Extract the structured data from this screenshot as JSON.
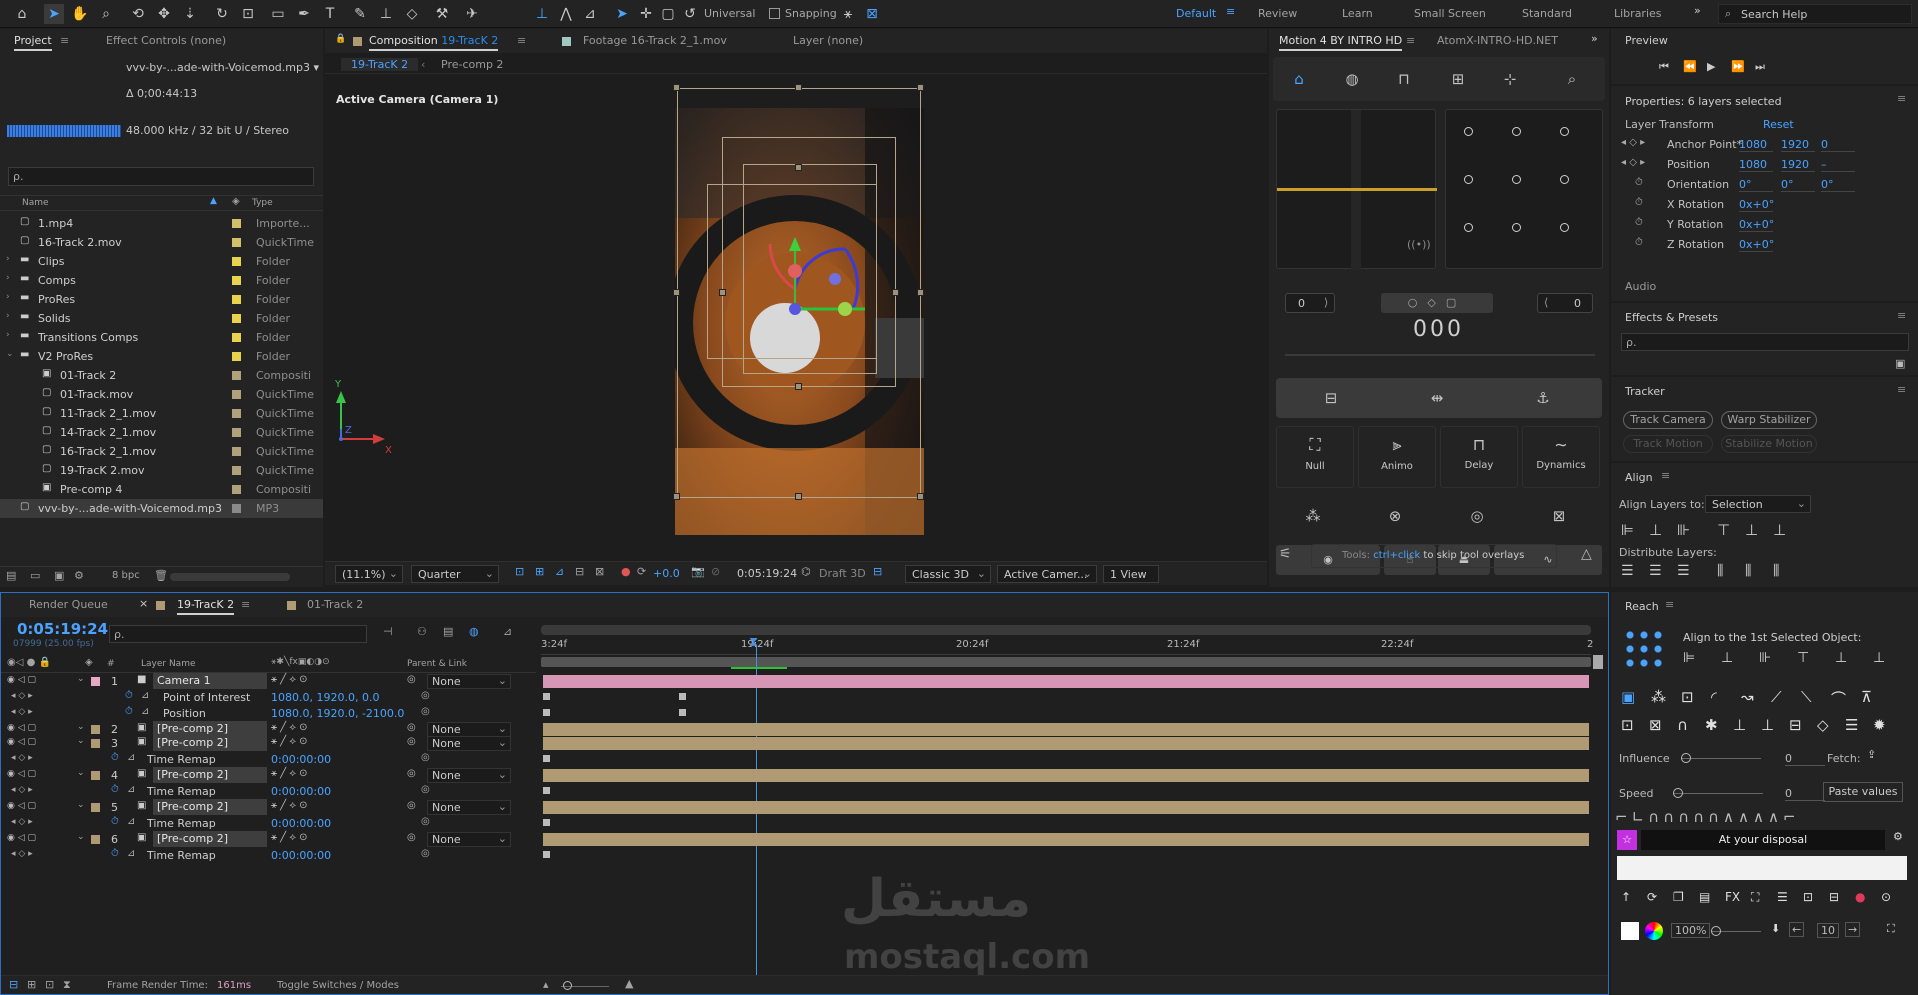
{
  "toolbar": {
    "universal_label": "Universal",
    "snapping_label": "Snapping",
    "workspaces": [
      "Default",
      "Review",
      "Learn",
      "Small Screen",
      "Standard",
      "Libraries"
    ],
    "search_placeholder": "Search Help"
  },
  "project": {
    "tab_project": "Project",
    "tab_effect_controls": "Effect Controls (none)",
    "selected_file": "vvv-by-...ade-with-Voicemod.mp3 ▾",
    "duration": "Δ 0;00:44:13",
    "audio_info": "48.000 kHz / 32 bit U / Stereo",
    "search_placeholder": "ρ.",
    "col_name": "Name",
    "col_type": "Type",
    "items": [
      {
        "name": "1.mp4",
        "type": "Importe...",
        "color": "#d1c06a",
        "icon": "file-icon"
      },
      {
        "name": "16-Track 2.mov",
        "type": "QuickTime",
        "color": "#d1c06a",
        "icon": "file-icon"
      },
      {
        "name": "Clips",
        "type": "Folder",
        "color": "#e8d34e",
        "icon": "folder-icon"
      },
      {
        "name": "Comps",
        "type": "Folder",
        "color": "#e8d34e",
        "icon": "folder-icon"
      },
      {
        "name": "ProRes",
        "type": "Folder",
        "color": "#e8d34e",
        "icon": "folder-icon"
      },
      {
        "name": "Solids",
        "type": "Folder",
        "color": "#e8d34e",
        "icon": "folder-icon"
      },
      {
        "name": "Transitions Comps",
        "type": "Folder",
        "color": "#e8d34e",
        "icon": "folder-icon"
      },
      {
        "name": "V2 ProRes",
        "type": "Folder",
        "color": "#e8d34e",
        "icon": "folder-icon"
      },
      {
        "name": "01-Track 2",
        "type": "Compositi",
        "color": "#b0a07c",
        "icon": "comp-icon"
      },
      {
        "name": "01-Track.mov",
        "type": "QuickTime",
        "color": "#b0a07c",
        "icon": "file-icon"
      },
      {
        "name": "11-Track 2_1.mov",
        "type": "QuickTime",
        "color": "#b0a07c",
        "icon": "file-icon"
      },
      {
        "name": "14-Track 2_1.mov",
        "type": "QuickTime",
        "color": "#b0a07c",
        "icon": "file-icon"
      },
      {
        "name": "16-Track 2_1.mov",
        "type": "QuickTime",
        "color": "#b0a07c",
        "icon": "file-icon"
      },
      {
        "name": "19-TracK 2.mov",
        "type": "QuickTime",
        "color": "#b0a07c",
        "icon": "file-icon"
      },
      {
        "name": "Pre-comp 4",
        "type": "Compositi",
        "color": "#b0a07c",
        "icon": "comp-icon"
      },
      {
        "name": "vvv-by-...ade-with-Voicemod.mp3",
        "type": "MP3",
        "color": "#8a8a8a",
        "icon": "file-icon"
      }
    ],
    "bpc": "8 bpc"
  },
  "composition": {
    "tab_label": "Composition",
    "tab_comp_name": "19-TracK 2",
    "tab_footage": "Footage  16-Track 2_1.mov",
    "tab_layer": "Layer  (none)",
    "sub_tab_active": "19-TracK 2",
    "sub_tab_other": "Pre-comp 2",
    "camera_label": "Active Camera (Camera 1)",
    "zoom": "(11.1%)",
    "quality": "Quarter",
    "exposure": "+0.0",
    "timecode": "0:05:19:24",
    "draft": "Draft 3D",
    "renderer": "Classic 3D",
    "view_camera": "Active Camer...",
    "views": "1 View"
  },
  "motion": {
    "tab_motion": "Motion 4 BY INTRO HD",
    "tab_atom": "AtomX-INTRO-HD.NET",
    "counter_left": "0",
    "counter_right": "0",
    "big_value": "000",
    "tools": [
      "Null",
      "Animo",
      "Delay",
      "Dynamics"
    ],
    "tip_prefix": "Tools:",
    "tip_key": "ctrl+click",
    "tip_suffix": "to skip tool overlays"
  },
  "preview": {
    "title": "Preview"
  },
  "properties": {
    "title": "Properties: 6 layers selected",
    "section": "Layer Transform",
    "reset": "Reset",
    "rows": [
      {
        "label": "Anchor Point*",
        "v1": "1080",
        "v2": "1920",
        "v3": "0"
      },
      {
        "label": "Position",
        "v1": "1080",
        "v2": "1920",
        "v3": "–"
      },
      {
        "label": "Orientation",
        "v1": "0°",
        "v2": "0°",
        "v3": "0°"
      },
      {
        "label": "X Rotation",
        "v1": "0x+0°",
        "v2": "",
        "v3": ""
      },
      {
        "label": "Y Rotation",
        "v1": "0x+0°",
        "v2": "",
        "v3": ""
      },
      {
        "label": "Z Rotation",
        "v1": "0x+0°",
        "v2": "",
        "v3": ""
      }
    ],
    "audio": "Audio"
  },
  "effects": {
    "title": "Effects & Presets",
    "search_placeholder": "ρ."
  },
  "tracker": {
    "title": "Tracker",
    "track_camera": "Track Camera",
    "warp": "Warp Stabilizer",
    "track_motion": "Track Motion",
    "stabilize": "Stabilize Motion"
  },
  "align": {
    "title": "Align",
    "align_to_label": "Align Layers to:",
    "align_to_value": "Selection",
    "distribute": "Distribute Layers:"
  },
  "timeline": {
    "tab_render": "Render Queue",
    "tab_comp": "19-TracK 2",
    "tab_other": "01-Track 2",
    "timecode": "0:05:19:24",
    "frames": "07999 (25.00 fps)",
    "search_placeholder": "ρ.",
    "col_hash": "#",
    "col_layer": "Layer Name",
    "col_parent": "Parent & Link",
    "ruler": [
      "3:24f",
      "19:24f",
      "20:24f",
      "21:24f",
      "22:24f",
      "2"
    ],
    "layers": [
      {
        "num": "1",
        "name": "Camera 1",
        "parent": "None",
        "color": "#e8a7c3",
        "kind": "layer"
      },
      {
        "num": "",
        "name": "Point of Interest",
        "value": "1080.0, 1920.0, 0.0",
        "kind": "prop"
      },
      {
        "num": "",
        "name": "Position",
        "value": "1080.0, 1920.0, -2100.0",
        "kind": "prop"
      },
      {
        "num": "2",
        "name": "[Pre-comp 2]",
        "parent": "None",
        "color": "#b09a73",
        "kind": "layer"
      },
      {
        "num": "3",
        "name": "[Pre-comp 2]",
        "parent": "None",
        "color": "#b09a73",
        "kind": "layer"
      },
      {
        "num": "",
        "name": "Time Remap",
        "value": "0:00:00:00",
        "kind": "prop"
      },
      {
        "num": "4",
        "name": "[Pre-comp 2]",
        "parent": "None",
        "color": "#b09a73",
        "kind": "layer"
      },
      {
        "num": "",
        "name": "Time Remap",
        "value": "0:00:00:00",
        "kind": "prop"
      },
      {
        "num": "5",
        "name": "[Pre-comp 2]",
        "parent": "None",
        "color": "#b09a73",
        "kind": "layer"
      },
      {
        "num": "",
        "name": "Time Remap",
        "value": "0:00:00:00",
        "kind": "prop"
      },
      {
        "num": "6",
        "name": "[Pre-comp 2]",
        "parent": "None",
        "color": "#b09a73",
        "kind": "layer"
      },
      {
        "num": "",
        "name": "Time Remap",
        "value": "0:00:00:00",
        "kind": "prop"
      }
    ],
    "frame_render_label": "Frame Render Time:",
    "frame_render_value": "161ms",
    "toggle_label": "Toggle Switches / Modes"
  },
  "reach": {
    "title": "Reach",
    "align_first": "Align to the 1st Selected Object:",
    "influence_label": "Influence",
    "influence_value": "0",
    "fetch_label": "Fetch:",
    "speed_label": "Speed",
    "speed_value": "0",
    "paste_values": "Paste values",
    "disposal": "At your disposal",
    "zoom": "100%",
    "count": "10"
  },
  "watermark": {
    "arabic": "مستقل",
    "latin": "mostaql.com"
  }
}
